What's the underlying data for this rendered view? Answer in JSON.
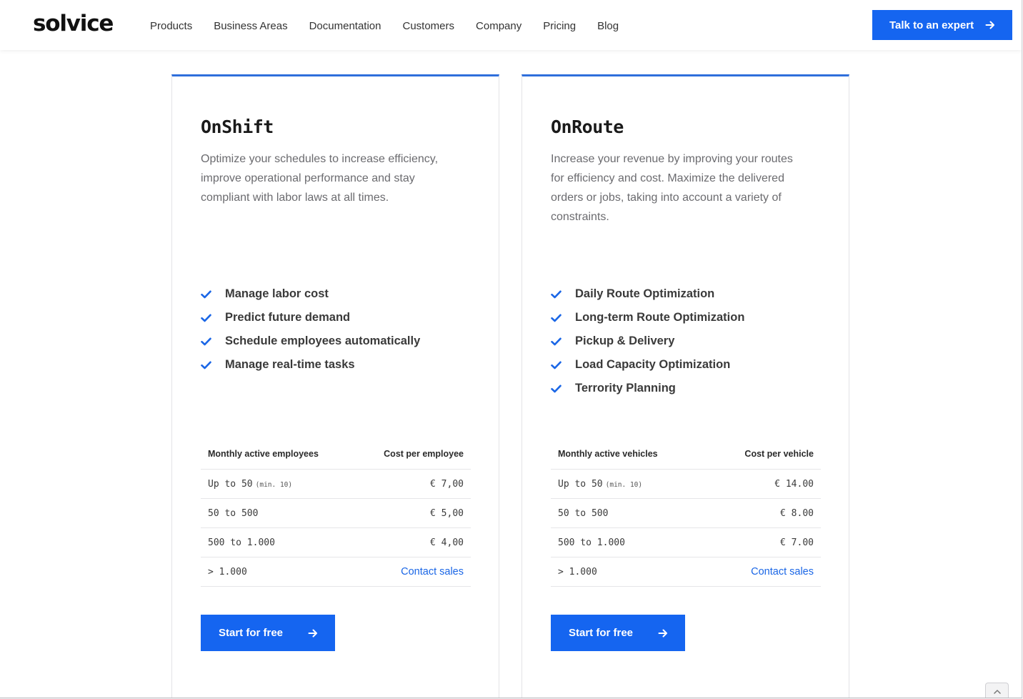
{
  "header": {
    "logo": "solvice",
    "nav": [
      "Products",
      "Business Areas",
      "Documentation",
      "Customers",
      "Company",
      "Pricing",
      "Blog"
    ],
    "cta_label": "Talk to an expert"
  },
  "accent_color": "#1565f0",
  "cards": [
    {
      "title": "OnShift",
      "description": "Optimize your schedules to increase efficiency, improve operational performance and stay compliant with labor laws at all times.",
      "features": [
        "Manage labor cost",
        "Predict future demand",
        "Schedule employees automatically",
        "Manage real-time tasks"
      ],
      "table": {
        "col1": "Monthly active employees",
        "col2": "Cost per employee",
        "rows": [
          {
            "range": "Up to 50",
            "note": "(min. 10)",
            "price": "€ 7,00"
          },
          {
            "range": "50 to 500",
            "note": "",
            "price": "€ 5,00"
          },
          {
            "range": "500 to 1.000",
            "note": "",
            "price": "€ 4,00"
          },
          {
            "range": "> 1.000",
            "note": "",
            "price": "Contact sales"
          }
        ]
      },
      "button_label": "Start for free"
    },
    {
      "title": "OnRoute",
      "description": "Increase your revenue by improving your routes for  efficiency and cost. Maximize the delivered orders or jobs, taking into account a variety of constraints.",
      "features": [
        "Daily Route Optimization",
        "Long-term Route Optimization",
        "Pickup & Delivery",
        "Load Capacity Optimization",
        "Terrority Planning"
      ],
      "table": {
        "col1": "Monthly active vehicles",
        "col2": "Cost per vehicle",
        "rows": [
          {
            "range": "Up to 50",
            "note": "(min. 10)",
            "price": "€ 14.00"
          },
          {
            "range": "50 to 500",
            "note": "",
            "price": "€ 8.00"
          },
          {
            "range": "500 to 1.000",
            "note": "",
            "price": "€ 7.00"
          },
          {
            "range": "> 1.000",
            "note": "",
            "price": "Contact sales"
          }
        ]
      },
      "button_label": "Start for free"
    }
  ]
}
